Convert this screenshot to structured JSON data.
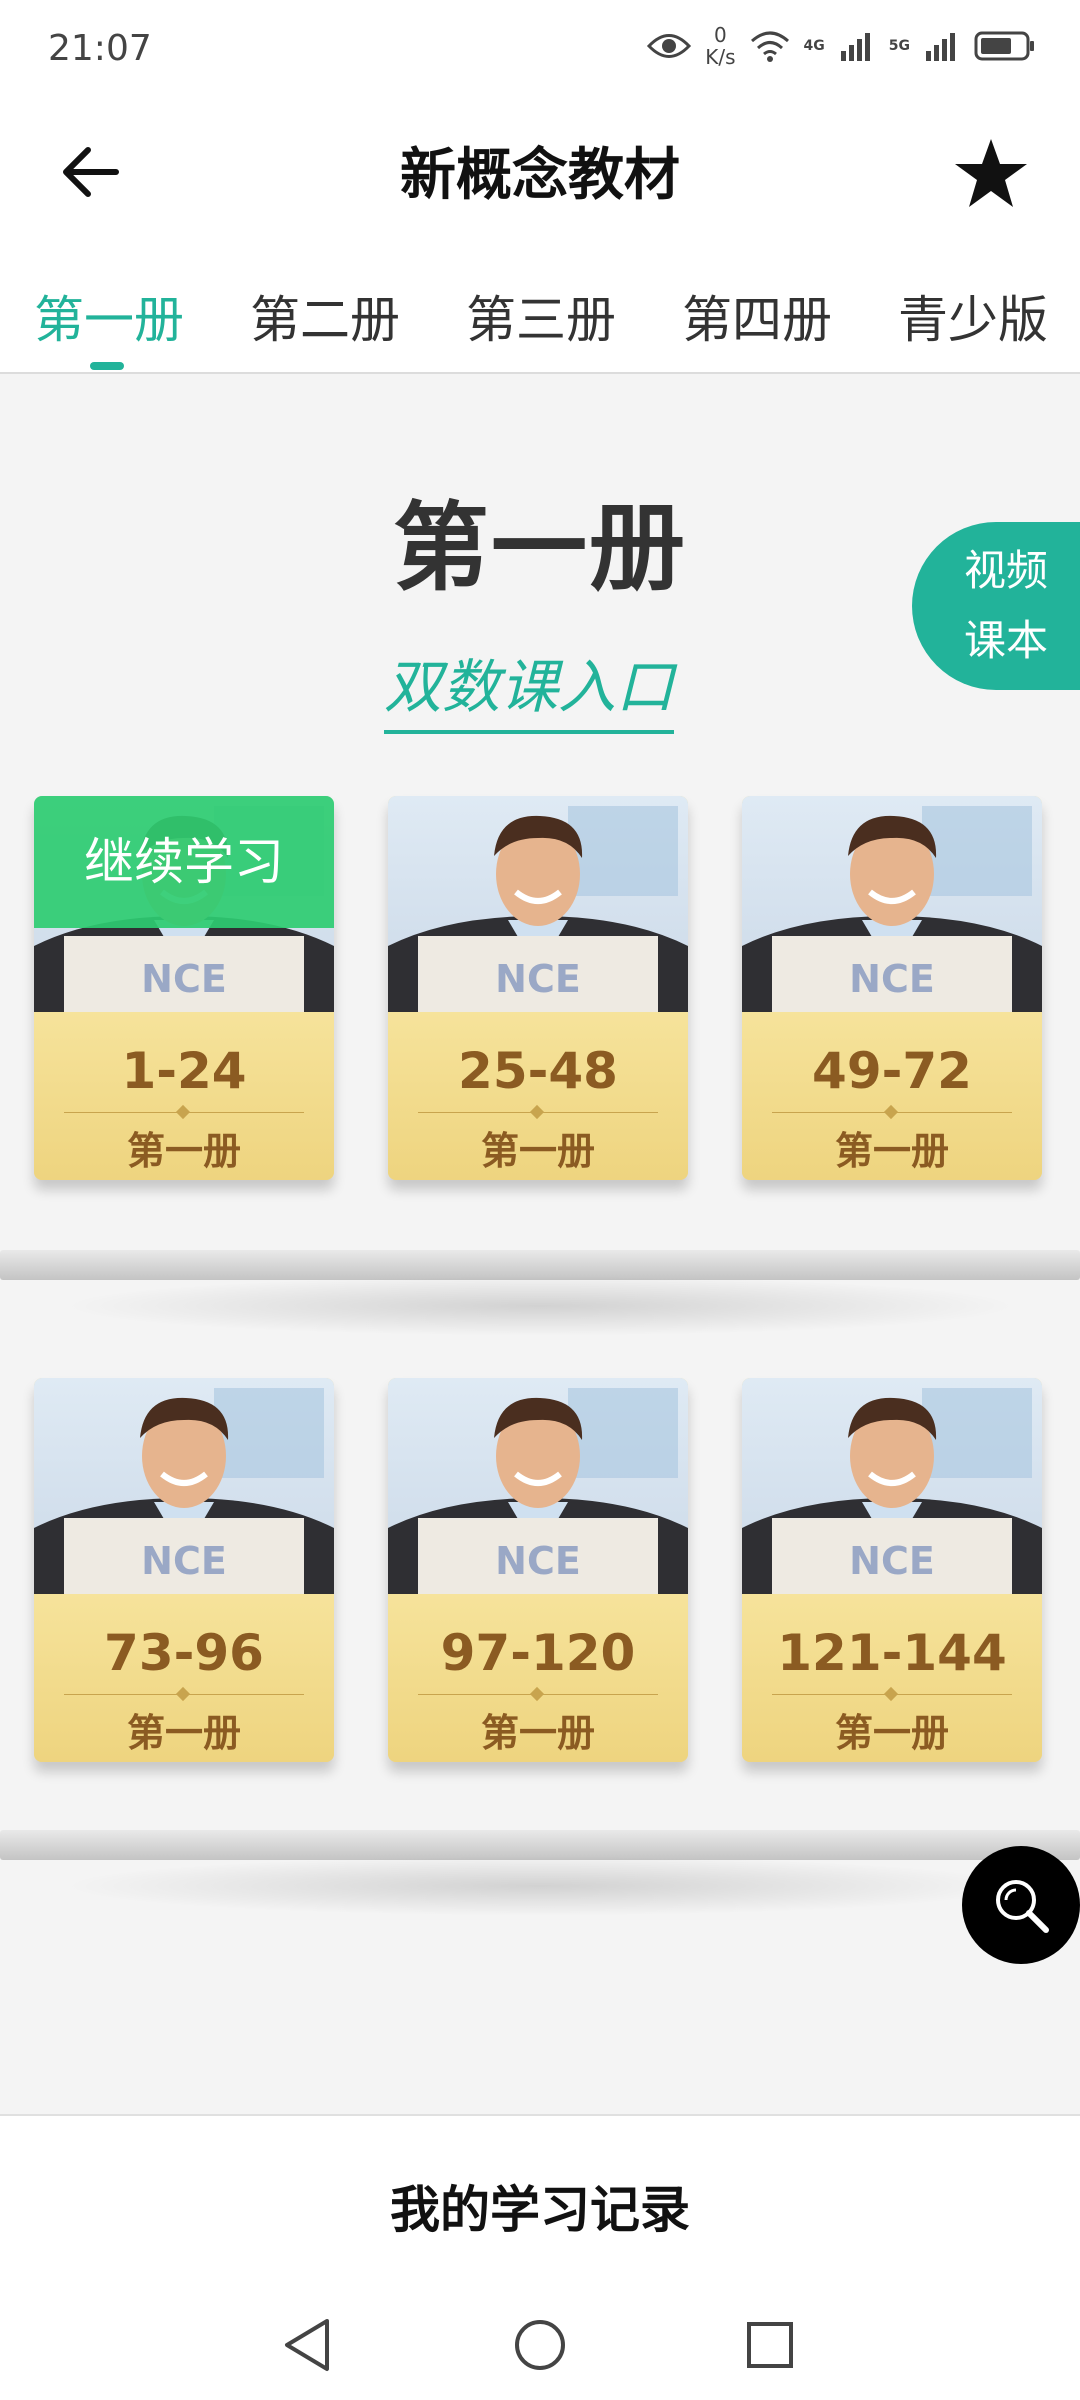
{
  "status_bar": {
    "time": "21:07",
    "speed_value": "0",
    "speed_unit": "K/s",
    "net1": "4G",
    "net2": "5G",
    "icons": [
      "eye-icon",
      "wifi-icon",
      "signal-icon",
      "signal-icon",
      "battery-icon"
    ]
  },
  "header": {
    "title": "新概念教材",
    "back_icon": "arrow-left-icon",
    "favorite_icon": "star-icon"
  },
  "tabs": [
    {
      "label": "第一册",
      "active": true
    },
    {
      "label": "第二册",
      "active": false
    },
    {
      "label": "第三册",
      "active": false
    },
    {
      "label": "第四册",
      "active": false
    },
    {
      "label": "青少版",
      "active": false
    }
  ],
  "main": {
    "heading": "第一册",
    "double_lesson_link": "双数课入口",
    "video_button": {
      "line1": "视频",
      "line2": "课本"
    },
    "continue_label": "继续学习",
    "books": [
      {
        "range": "1-24",
        "volume": "第一册",
        "cover_text": "NCE"
      },
      {
        "range": "25-48",
        "volume": "第一册",
        "cover_text": "NCE"
      },
      {
        "range": "49-72",
        "volume": "第一册",
        "cover_text": "NCE"
      },
      {
        "range": "73-96",
        "volume": "第一册",
        "cover_text": "NCE"
      },
      {
        "range": "97-120",
        "volume": "第一册",
        "cover_text": "NCE"
      },
      {
        "range": "121-144",
        "volume": "第一册",
        "cover_text": "NCE"
      }
    ]
  },
  "footer": {
    "record_label": "我的学习记录"
  },
  "colors": {
    "accent": "#22b39a",
    "continue_green": "#2ecc71",
    "book_label_bg": "#f3db87",
    "book_text": "#8b5b22"
  },
  "nav": [
    "back-triangle-icon",
    "home-circle-icon",
    "recents-square-icon"
  ]
}
